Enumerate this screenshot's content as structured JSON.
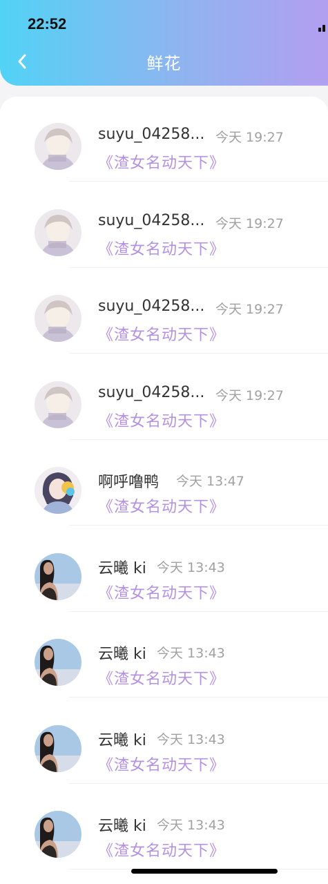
{
  "status_bar": {
    "time": "22:52"
  },
  "nav": {
    "back_icon": "chevron-left-icon",
    "title": "鲜花"
  },
  "colors": {
    "gradient_start": "#52d3f6",
    "gradient_end": "#b29ff0",
    "book_title": "#b491e0",
    "timestamp": "#a0a0a0",
    "name": "#333333"
  },
  "list": [
    {
      "name": "suyu_04258...",
      "time": "今天 19:27",
      "book": "《渣女名动天下》",
      "avatar": "avatar-boy-sketch"
    },
    {
      "name": "suyu_04258...",
      "time": "今天 19:27",
      "book": "《渣女名动天下》",
      "avatar": "avatar-boy-sketch"
    },
    {
      "name": "suyu_04258...",
      "time": "今天 19:27",
      "book": "《渣女名动天下》",
      "avatar": "avatar-boy-sketch"
    },
    {
      "name": "suyu_04258...",
      "time": "今天 19:27",
      "book": "《渣女名动天下》",
      "avatar": "avatar-boy-sketch"
    },
    {
      "name": "啊呼噜鸭",
      "time": "今天 13:47",
      "book": "《渣女名动天下》",
      "avatar": "avatar-anime-girl"
    },
    {
      "name": "云曦 ki",
      "time": "今天 13:43",
      "book": "《渣女名动天下》",
      "avatar": "avatar-girl-sky"
    },
    {
      "name": "云曦 ki",
      "time": "今天 13:43",
      "book": "《渣女名动天下》",
      "avatar": "avatar-girl-sky"
    },
    {
      "name": "云曦 ki",
      "time": "今天 13:43",
      "book": "《渣女名动天下》",
      "avatar": "avatar-girl-sky"
    },
    {
      "name": "云曦 ki",
      "time": "今天 13:43",
      "book": "《渣女名动天下》",
      "avatar": "avatar-girl-sky"
    }
  ]
}
